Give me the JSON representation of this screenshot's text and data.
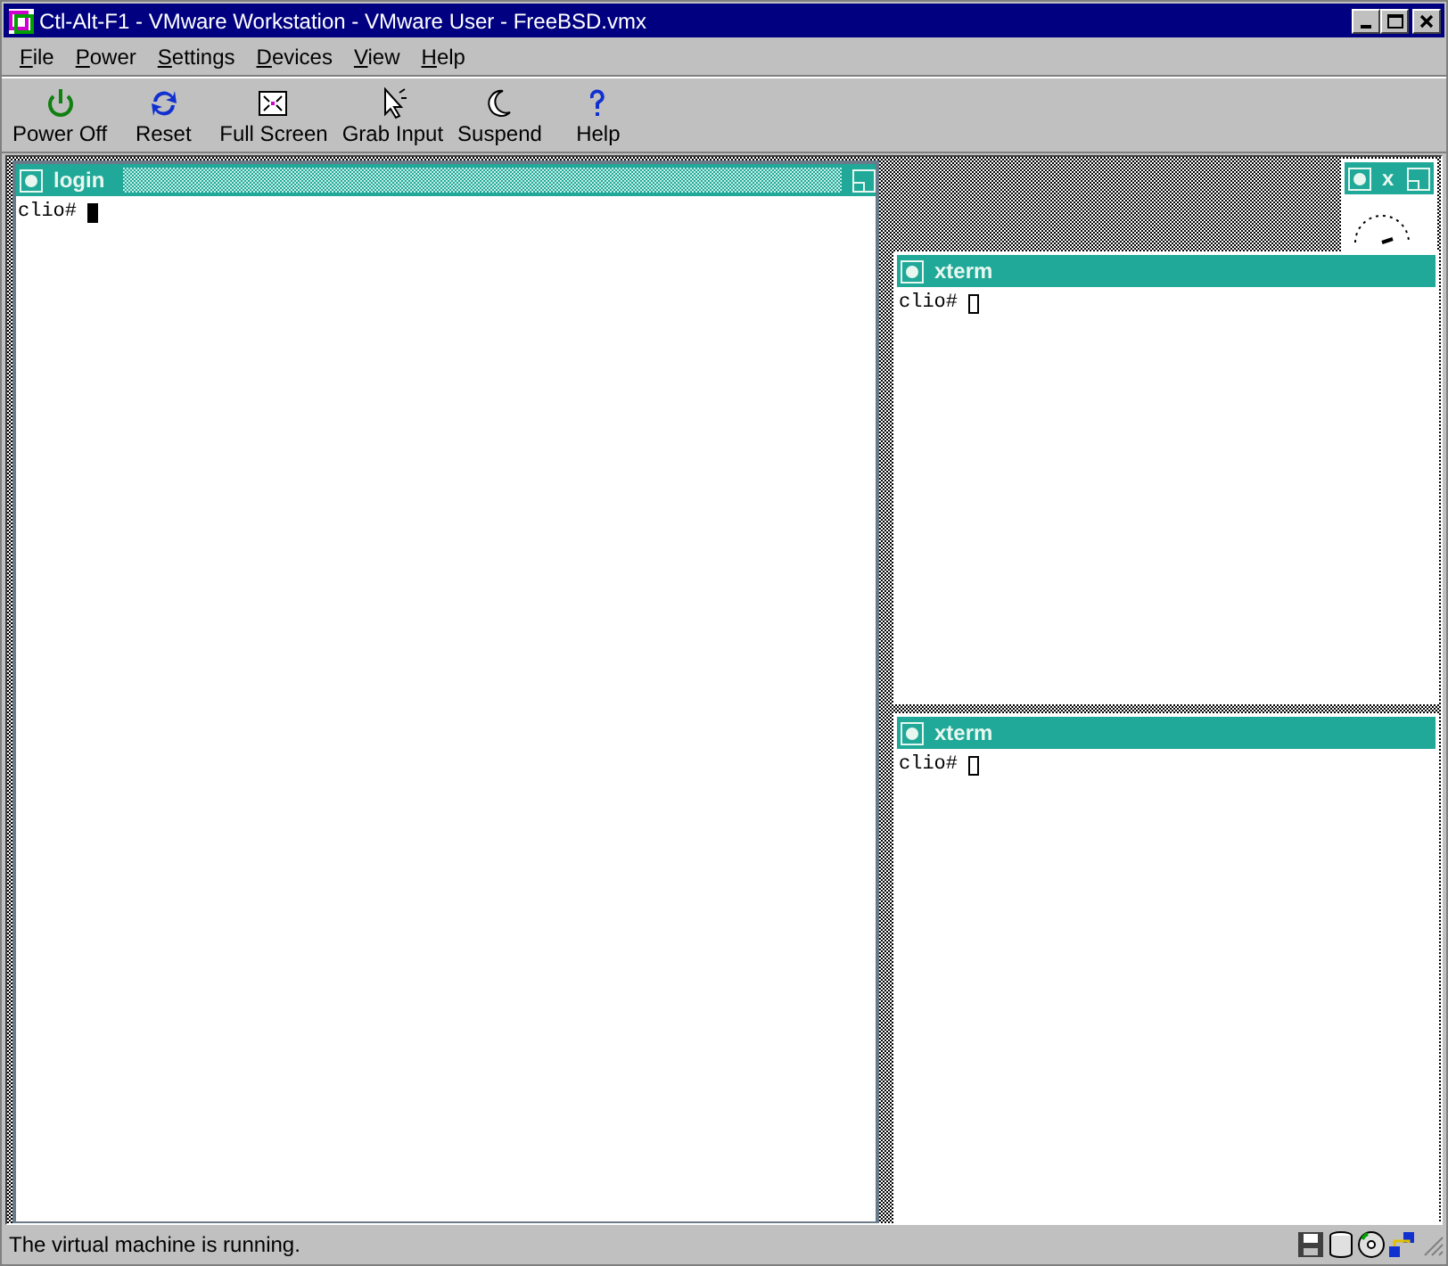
{
  "window": {
    "title": "Ctl-Alt-F1 - VMware Workstation - VMware User - FreeBSD.vmx"
  },
  "menu": [
    "File",
    "Power",
    "Settings",
    "Devices",
    "View",
    "Help"
  ],
  "toolbar": [
    {
      "kind": "power",
      "label": "Power Off"
    },
    {
      "kind": "reset",
      "label": "Reset"
    },
    {
      "kind": "fullscreen",
      "label": "Full Screen"
    },
    {
      "kind": "grab",
      "label": "Grab Input"
    },
    {
      "kind": "suspend",
      "label": "Suspend"
    },
    {
      "kind": "help",
      "label": "Help"
    }
  ],
  "desktop": {
    "windows": [
      {
        "kind": "terminal",
        "title": "login",
        "focused": true,
        "prompt": "clio#",
        "cursor_filled": true
      },
      {
        "kind": "clock",
        "title": "x",
        "focused": false
      },
      {
        "kind": "terminal",
        "title": "xterm",
        "focused": false,
        "prompt": "clio#",
        "cursor_filled": false
      },
      {
        "kind": "terminal",
        "title": "xterm",
        "focused": false,
        "prompt": "clio#",
        "cursor_filled": false
      }
    ]
  },
  "status_bar": {
    "text": "The virtual machine is running."
  }
}
